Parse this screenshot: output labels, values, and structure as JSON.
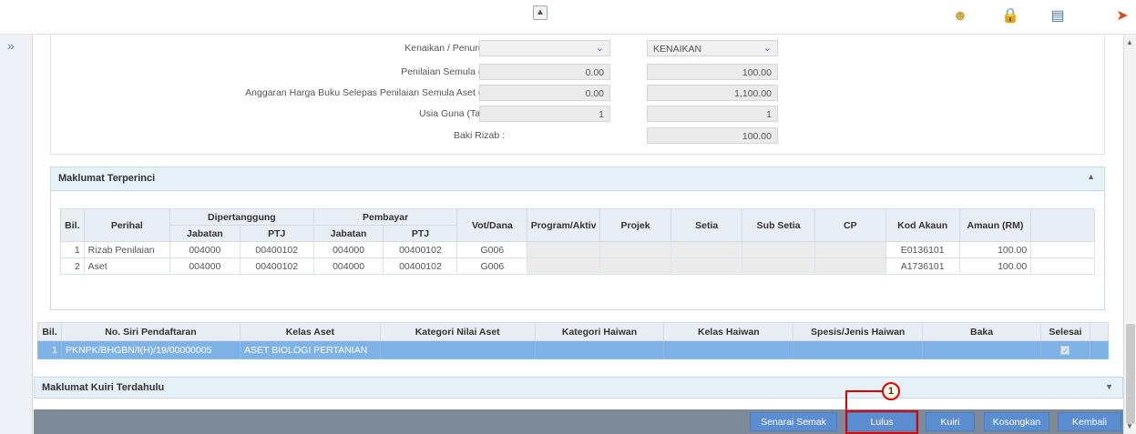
{
  "form": {
    "rows": [
      {
        "label": "Kenaikan / Penurunan :",
        "value1": "",
        "value2": "KENAIKAN",
        "select": true,
        "show_value1": true
      },
      {
        "label": "Penilaian Semula (RM) :",
        "value1": "0.00",
        "value2": "100.00",
        "select": false,
        "show_value1": true
      },
      {
        "label": "Anggaran Harga Buku Selepas Penilaian Semula Aset (RM) :",
        "value1": "0.00",
        "value2": "1,100.00",
        "select": false,
        "show_value1": true
      },
      {
        "label": "Usia Guna (Tahun) :",
        "value1": "1",
        "value2": "1",
        "select": false,
        "show_value1": true
      },
      {
        "label": "Baki Rizab :",
        "value1": "",
        "value2": "100.00",
        "select": false,
        "show_value1": false
      }
    ]
  },
  "detail_section": {
    "title": "Maklumat Terperinci",
    "headers": {
      "bil": "Bil.",
      "perihal": "Perihal",
      "dipertanggung": "Dipertanggung",
      "pembayar": "Pembayar",
      "jabatan": "Jabatan",
      "ptj": "PTJ",
      "vot": "Vot/Dana",
      "program": "Program/Aktiv",
      "projek": "Projek",
      "setia": "Setia",
      "sub_setia": "Sub Setia",
      "cp": "CP",
      "kod_akaun": "Kod Akaun",
      "amaun": "Amaun (RM)"
    },
    "rows": [
      {
        "bil": "1",
        "perihal": "Rizab Penilaian",
        "d_jabatan": "004000",
        "d_ptj": "00400102",
        "p_jabatan": "004000",
        "p_ptj": "00400102",
        "vot": "G006",
        "program": "",
        "projek": "",
        "setia": "",
        "sub_setia": "",
        "cp": "",
        "kod_akaun": "E0136101",
        "amaun": "100.00"
      },
      {
        "bil": "2",
        "perihal": "Aset",
        "d_jabatan": "004000",
        "d_ptj": "00400102",
        "p_jabatan": "004000",
        "p_ptj": "00400102",
        "vot": "G006",
        "program": "",
        "projek": "",
        "setia": "",
        "sub_setia": "",
        "cp": "",
        "kod_akaun": "A1736101",
        "amaun": "100.00"
      }
    ]
  },
  "asset_table": {
    "headers": [
      "Bil.",
      "No. Siri Pendaftaran",
      "Kelas Aset",
      "Kategori Nilai Aset",
      "Kategori Haiwan",
      "Kelas Haiwan",
      "Spesis/Jenis Haiwan",
      "Baka",
      "Selesai"
    ],
    "row": {
      "bil": "1",
      "no_siri": "PKNPK/BHGBN/I(H)/19/00000005",
      "kelas_aset": "ASET BIOLOGI PERTANIAN",
      "kategori_nilai": "",
      "kategori_haiwan": "",
      "kelas_haiwan": "",
      "spesis": "",
      "baka": "",
      "selesai_checked": true
    }
  },
  "kuiri_section": {
    "title": "Maklumat Kuiri Terdahulu"
  },
  "actions": {
    "senarai_semak": "Senarai Semak",
    "lulus": "Lulus",
    "kuiri": "Kuiri",
    "kosongkan": "Kosongkan",
    "kembali": "Kembali"
  },
  "annotation": {
    "step": "1",
    "color": "#e00000"
  },
  "icons": {
    "collapse": "double-chevron-up-icon",
    "user": "user-icon",
    "lock": "lock-icon",
    "calendar": "calendar-icon",
    "logout": "logout-icon",
    "expand": "double-chevron-right-icon"
  }
}
